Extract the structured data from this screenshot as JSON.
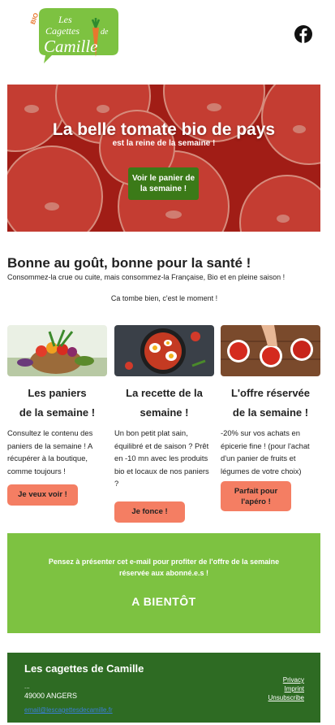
{
  "header": {
    "logo_text": {
      "bio": "BIO",
      "line1": "Les",
      "line2": "Cagettes",
      "line3": "de",
      "line4": "Camille"
    },
    "social_icon": "facebook-icon"
  },
  "hero": {
    "title": "La belle tomate bio de pays",
    "subtitle": "est la reine de la semaine !",
    "button_label": "Voir le panier de la semaine !"
  },
  "intro": {
    "title": "Bonne au goût, bonne pour la santé !",
    "line1": "Consommez-la crue ou cuite, mais consommez-la Française, Bio et en pleine saison !",
    "line2": "Ca tombe bien, c'est le moment !"
  },
  "columns": [
    {
      "title_line1": "Les paniers",
      "title_line2": "de la semaine !",
      "text": "Consultez le contenu des paniers de la semaine ! A récupérer à la boutique, comme toujours !",
      "button_label": "Je veux voir !"
    },
    {
      "title_line1": "La recette de la",
      "title_line2": "semaine !",
      "text": "Un bon petit plat sain, équilibré et de saison ? Prêt en -10 mn avec les produits bio et locaux de nos paniers ?",
      "button_label": "Je fonce !"
    },
    {
      "title_line1": "L'offre réservée",
      "title_line2": "de la semaine !",
      "text": "-20% sur vos achats en épicerie fine ! (pour l'achat d'un panier de fruits et légumes de votre choix)",
      "button_label": "Parfait pour l'apéro !"
    }
  ],
  "band": {
    "text": "Pensez à présenter cet e-mail pour profiter de l'offre de la semaine réservée aux abonné.e.s !",
    "cta": "A BIENTÔT"
  },
  "footer": {
    "name": "Les cagettes de Camille",
    "address_dots": "...",
    "city": "49000 ANGERS",
    "email": "email@lescagettesdecamille.fr",
    "links": [
      "Privacy",
      "Imprint",
      "Unsubscribe"
    ]
  },
  "colors": {
    "accent_green": "#3b7a18",
    "band_green": "#7dc241",
    "footer_green": "#2e6b23",
    "button_salmon": "#f47e63",
    "tomato_red": "#d8352a"
  }
}
